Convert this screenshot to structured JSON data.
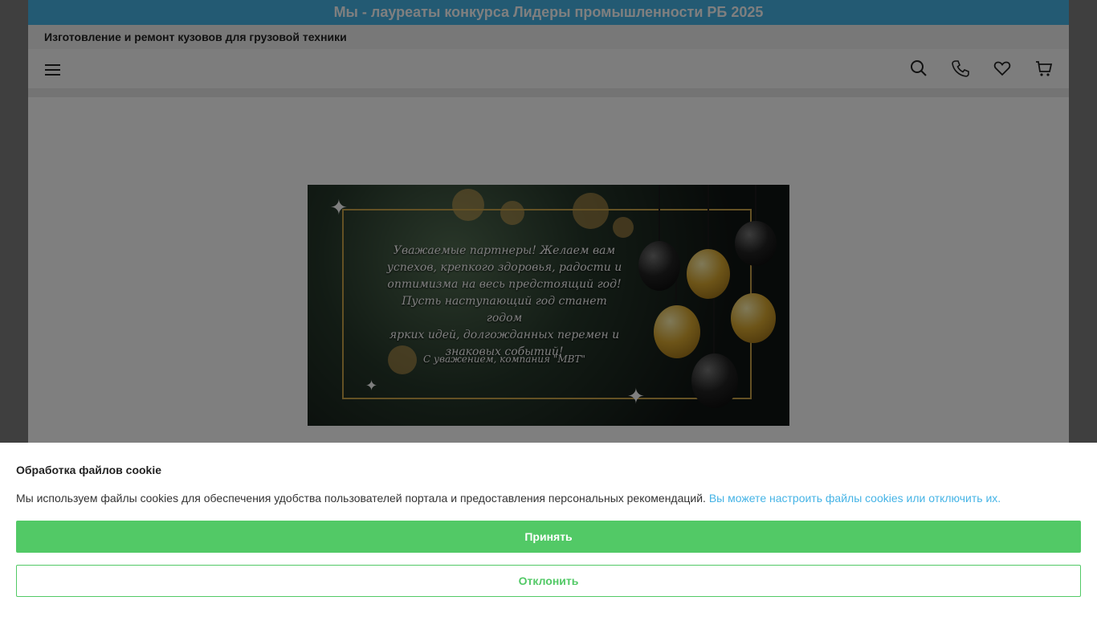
{
  "header": {
    "top_banner": "Мы - лауреаты конкурса Лидеры промышленности РБ 2025",
    "tagline": "Изготовление и ремонт кузовов для грузовой техники"
  },
  "navbar": {
    "icons": [
      "menu-icon",
      "search-icon",
      "phone-icon",
      "heart-icon",
      "cart-icon"
    ]
  },
  "banner": {
    "greeting_lines": [
      "Уважаемые партнеры! Желаем вам",
      "успехов, крепкого здоровья, радости и",
      "оптимизма на весь предстоящий год!",
      "Пусть наступающий год станет годом",
      "ярких идей, долгожданных  перемен и",
      "знаковых событий!"
    ],
    "signature": "С уважением, компания \"МВТ\""
  },
  "cookie": {
    "title": "Обработка файлов cookie",
    "text": "Мы используем файлы cookies для обеспечения удобства пользователей портала и предоставления персональных рекомендаций.",
    "link": "Вы можете настроить файлы cookies или отключить их.",
    "accept_label": "Принять",
    "decline_label": "Отклонить"
  },
  "colors": {
    "accent": "#46b4e6",
    "accept": "#52c966"
  }
}
